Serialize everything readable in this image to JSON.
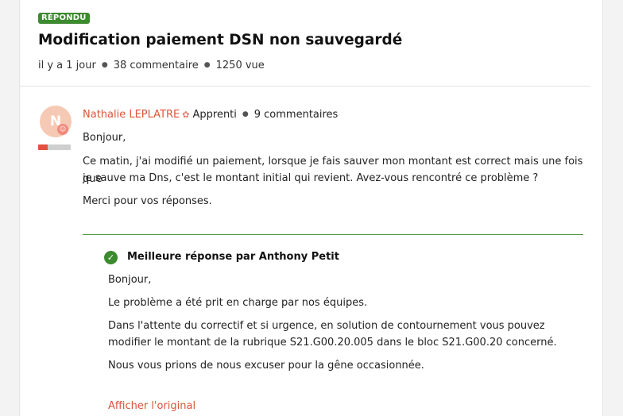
{
  "post": {
    "status_badge": "RÉPONDU",
    "title": "Modification paiement DSN non sauvegardé",
    "time_ago": "il y a 1 jour",
    "comments": "38 commentaire",
    "views": "1250 vue"
  },
  "question": {
    "avatar_initial": "N",
    "author_name": "Nathalie LEPLATRE",
    "author_badge_icon": "brain-icon",
    "role": "Apprenti",
    "user_comments": "9 commentaires",
    "rank_progress": 0.3,
    "greeting": "Bonjour,",
    "body_line1": "Ce matin, j'ai modifié un paiement, lorsque je fais sauver mon montant est correct mais une fois que",
    "body_line2": "je sauve ma Dns, c'est le montant initial qui revient. Avez-vous rencontré ce problème ?",
    "closing": "Merci pour vos réponses."
  },
  "best_answer": {
    "heading": "Meilleure réponse par Anthony Petit",
    "greeting": "Bonjour,",
    "line1": "Le problème a été prit en charge par nos équipes.",
    "line2": "Dans l'attente du correctif et si urgence, en solution de contournement vous pouvez",
    "line3": "modifier le montant de la rubrique S21.G00.20.005 dans le bloc S21.G00.20 concerné.",
    "line4": "Nous vous prions de nous excuser pour la gêne occasionnée.",
    "show_original": "Afficher l'original"
  },
  "colors": {
    "accent_orange": "#d9553a",
    "success_green": "#3d8b2f",
    "rank_red": "#e4503f"
  }
}
